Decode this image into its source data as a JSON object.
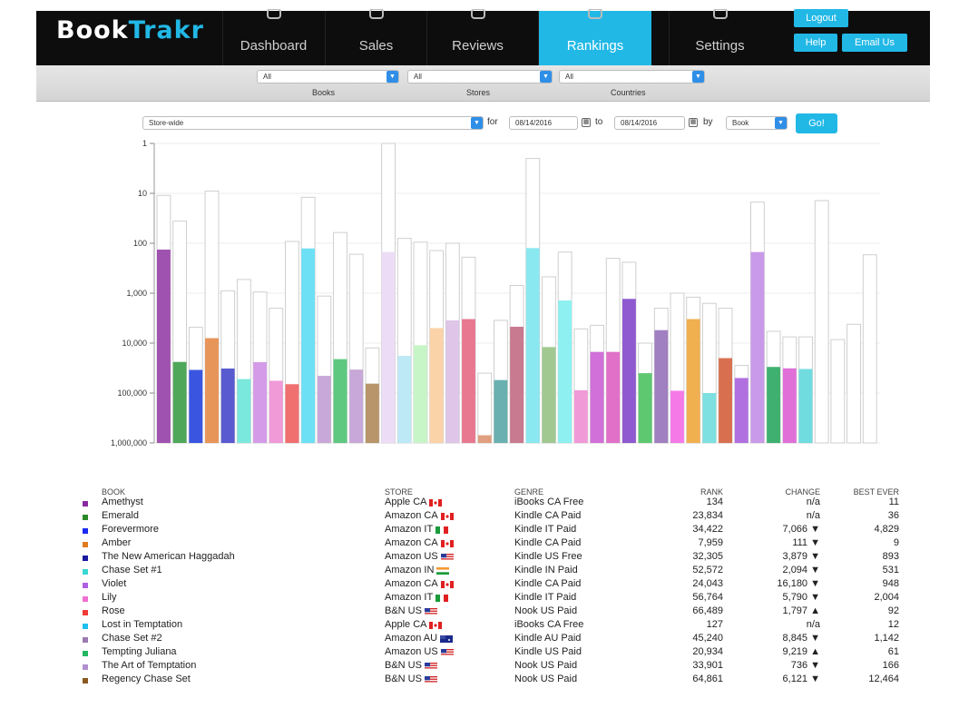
{
  "app": {
    "logo_part1": "Book",
    "logo_part2": "Trakr",
    "nav": [
      {
        "label": "Dashboard",
        "icon": "dashboard-icon"
      },
      {
        "label": "Sales",
        "icon": "sales-icon"
      },
      {
        "label": "Reviews",
        "icon": "reviews-icon"
      },
      {
        "label": "Rankings",
        "icon": "rankings-icon",
        "active": true
      },
      {
        "label": "Settings",
        "icon": "gear-icon"
      }
    ],
    "logout": "Logout",
    "help": "Help",
    "email": "Email Us",
    "accent": "#21b8e6"
  },
  "filters": {
    "books_value": "All",
    "books_label": "Books",
    "stores_value": "All",
    "stores_label": "Stores",
    "countries_value": "All",
    "countries_label": "Countries"
  },
  "range": {
    "scope": "Store-wide",
    "for_label": "for",
    "from_date": "08/14/2016",
    "to_label": "to",
    "to_date": "08/14/2016",
    "by_label": "by",
    "by_value": "Book",
    "go": "Go!"
  },
  "chart_data": {
    "type": "bar",
    "scale": "log",
    "y_reversed": true,
    "ylim": [
      1,
      1000000
    ],
    "y_ticks": [
      "1",
      "10",
      "100",
      "1,000",
      "10,000",
      "100,000",
      "1,000,000"
    ],
    "grid": true,
    "bars": [
      {
        "rank": 134,
        "best": 11,
        "color": "#a052b0"
      },
      {
        "rank": 23834,
        "best": 36,
        "color": "#4fa85a"
      },
      {
        "rank": 34422,
        "best": 4829,
        "color": "#3a56e0"
      },
      {
        "rank": 7959,
        "best": 9,
        "color": "#e8955a"
      },
      {
        "rank": 32305,
        "best": 893,
        "color": "#5a5ad0"
      },
      {
        "rank": 52572,
        "best": 531,
        "color": "#7ae8dd"
      },
      {
        "rank": 24043,
        "best": 948,
        "color": "#d49be8"
      },
      {
        "rank": 56764,
        "best": 2004,
        "color": "#f09ad8"
      },
      {
        "rank": 66489,
        "best": 92,
        "color": "#f07070"
      },
      {
        "rank": 127,
        "best": 12,
        "color": "#6ee0f5"
      },
      {
        "rank": 45240,
        "best": 1142,
        "color": "#c8a8d8"
      },
      {
        "rank": 20934,
        "best": 61,
        "color": "#5ec880"
      },
      {
        "rank": 33901,
        "best": 166,
        "color": "#c8a8d8"
      },
      {
        "rank": 64861,
        "best": 12464,
        "color": "#b8956a"
      },
      {
        "rank": 150,
        "best": 1,
        "color": "#ecdcf5"
      },
      {
        "rank": 18000,
        "best": 80,
        "color": "#bde8f5"
      },
      {
        "rank": 11000,
        "best": 95,
        "color": "#c8f5c8"
      },
      {
        "rank": 5000,
        "best": 140,
        "color": "#fbd3a8"
      },
      {
        "rank": 3500,
        "best": 100,
        "color": "#dfc5e8"
      },
      {
        "rank": 3300,
        "best": 190,
        "color": "#e87890"
      },
      {
        "rank": 700000,
        "best": 40000,
        "color": "#e0a080"
      },
      {
        "rank": 55000,
        "best": 3500,
        "color": "#6ab0b0"
      },
      {
        "rank": 4700,
        "best": 700,
        "color": "#c87a90"
      },
      {
        "rank": 125,
        "best": 2,
        "color": "#8ae8f0"
      },
      {
        "rank": 12000,
        "best": 470,
        "color": "#a0c890"
      },
      {
        "rank": 1400,
        "best": 150,
        "color": "#8ef0f0"
      },
      {
        "rank": 88000,
        "best": 5200,
        "color": "#f09ad8"
      },
      {
        "rank": 15000,
        "best": 4400,
        "color": "#d070d8"
      },
      {
        "rank": 15000,
        "best": 200,
        "color": "#e070c8"
      },
      {
        "rank": 1300,
        "best": 240,
        "color": "#8f5ad0"
      },
      {
        "rank": 40000,
        "best": 10000,
        "color": "#5ec870"
      },
      {
        "rank": 5500,
        "best": 2000,
        "color": "#a080c0"
      },
      {
        "rank": 90000,
        "best": 1000,
        "color": "#f57ae8"
      },
      {
        "rank": 3300,
        "best": 1200,
        "color": "#f0b050"
      },
      {
        "rank": 100000,
        "best": 1600,
        "color": "#7ee0e0"
      },
      {
        "rank": 20000,
        "best": 2000,
        "color": "#d87050"
      },
      {
        "rank": 50000,
        "best": 28000,
        "color": "#b070e0"
      },
      {
        "rank": 150,
        "best": 15,
        "color": "#c89ae8"
      },
      {
        "rank": 30000,
        "best": 5800,
        "color": "#40b070"
      },
      {
        "rank": 32000,
        "best": 7500,
        "color": "#e070d8"
      },
      {
        "rank": 33000,
        "best": 7500,
        "color": "#70dce0"
      },
      {
        "rank": null,
        "best": 14,
        "color": "#ffffff"
      },
      {
        "rank": null,
        "best": 8500,
        "color": "#ffffff"
      },
      {
        "rank": null,
        "best": 4200,
        "color": "#ffffff"
      },
      {
        "rank": null,
        "best": 170,
        "color": "#ffffff"
      }
    ]
  },
  "table": {
    "headers": {
      "book": "BOOK",
      "store": "STORE",
      "genre": "GENRE",
      "rank": "RANK",
      "change": "CHANGE",
      "best": "BEST EVER"
    },
    "rows": [
      {
        "color": "#8a2aa0",
        "book": "Amethyst",
        "store": "Apple CA",
        "flag": "ca",
        "genre": "iBooks CA Free",
        "rank": "134",
        "change": "n/a",
        "best": "11"
      },
      {
        "color": "#2a8a2a",
        "book": "Emerald",
        "store": "Amazon CA",
        "flag": "ca",
        "genre": "Kindle CA Paid",
        "rank": "23,834",
        "change": "n/a",
        "best": "36"
      },
      {
        "color": "#1a2af0",
        "book": "Forevermore",
        "store": "Amazon IT",
        "flag": "it",
        "genre": "Kindle IT Paid",
        "rank": "34,422",
        "change": "7,066 ▼",
        "best": "4,829"
      },
      {
        "color": "#e07a20",
        "book": "Amber",
        "store": "Amazon CA",
        "flag": "ca",
        "genre": "Kindle CA Paid",
        "rank": "7,959",
        "change": "111 ▼",
        "best": "9"
      },
      {
        "color": "#1a1aa0",
        "book": "The New American Haggadah",
        "store": "Amazon US",
        "flag": "us",
        "genre": "Kindle US Free",
        "rank": "32,305",
        "change": "3,879 ▼",
        "best": "893"
      },
      {
        "color": "#3ad8d0",
        "book": "Chase Set #1",
        "store": "Amazon IN",
        "flag": "in",
        "genre": "Kindle IN Paid",
        "rank": "52,572",
        "change": "2,094 ▼",
        "best": "531"
      },
      {
        "color": "#b060e0",
        "book": "Violet",
        "store": "Amazon CA",
        "flag": "ca",
        "genre": "Kindle CA Paid",
        "rank": "24,043",
        "change": "16,180 ▼",
        "best": "948"
      },
      {
        "color": "#f070d0",
        "book": "Lily",
        "store": "Amazon IT",
        "flag": "it",
        "genre": "Kindle IT Paid",
        "rank": "56,764",
        "change": "5,790 ▼",
        "best": "2,004"
      },
      {
        "color": "#f03a3a",
        "book": "Rose",
        "store": "B&N US",
        "flag": "us",
        "genre": "Nook US Paid",
        "rank": "66,489",
        "change": "1,797 ▲",
        "best": "92"
      },
      {
        "color": "#20c0f0",
        "book": "Lost in Temptation",
        "store": "Apple CA",
        "flag": "ca",
        "genre": "iBooks CA Free",
        "rank": "127",
        "change": "n/a",
        "best": "12"
      },
      {
        "color": "#9a7ab0",
        "book": "Chase Set #2",
        "store": "Amazon AU",
        "flag": "au",
        "genre": "Kindle AU Paid",
        "rank": "45,240",
        "change": "8,845 ▼",
        "best": "1,142"
      },
      {
        "color": "#20b860",
        "book": "Tempting Juliana",
        "store": "Amazon US",
        "flag": "us",
        "genre": "Kindle US Paid",
        "rank": "20,934",
        "change": "9,219 ▲",
        "best": "61"
      },
      {
        "color": "#b090d0",
        "book": "The Art of Temptation",
        "store": "B&N US",
        "flag": "us",
        "genre": "Nook US Paid",
        "rank": "33,901",
        "change": "736 ▼",
        "best": "166"
      },
      {
        "color": "#8a5a20",
        "book": "Regency Chase Set",
        "store": "B&N US",
        "flag": "us",
        "genre": "Nook US Paid",
        "rank": "64,861",
        "change": "6,121 ▼",
        "best": "12,464"
      }
    ]
  }
}
